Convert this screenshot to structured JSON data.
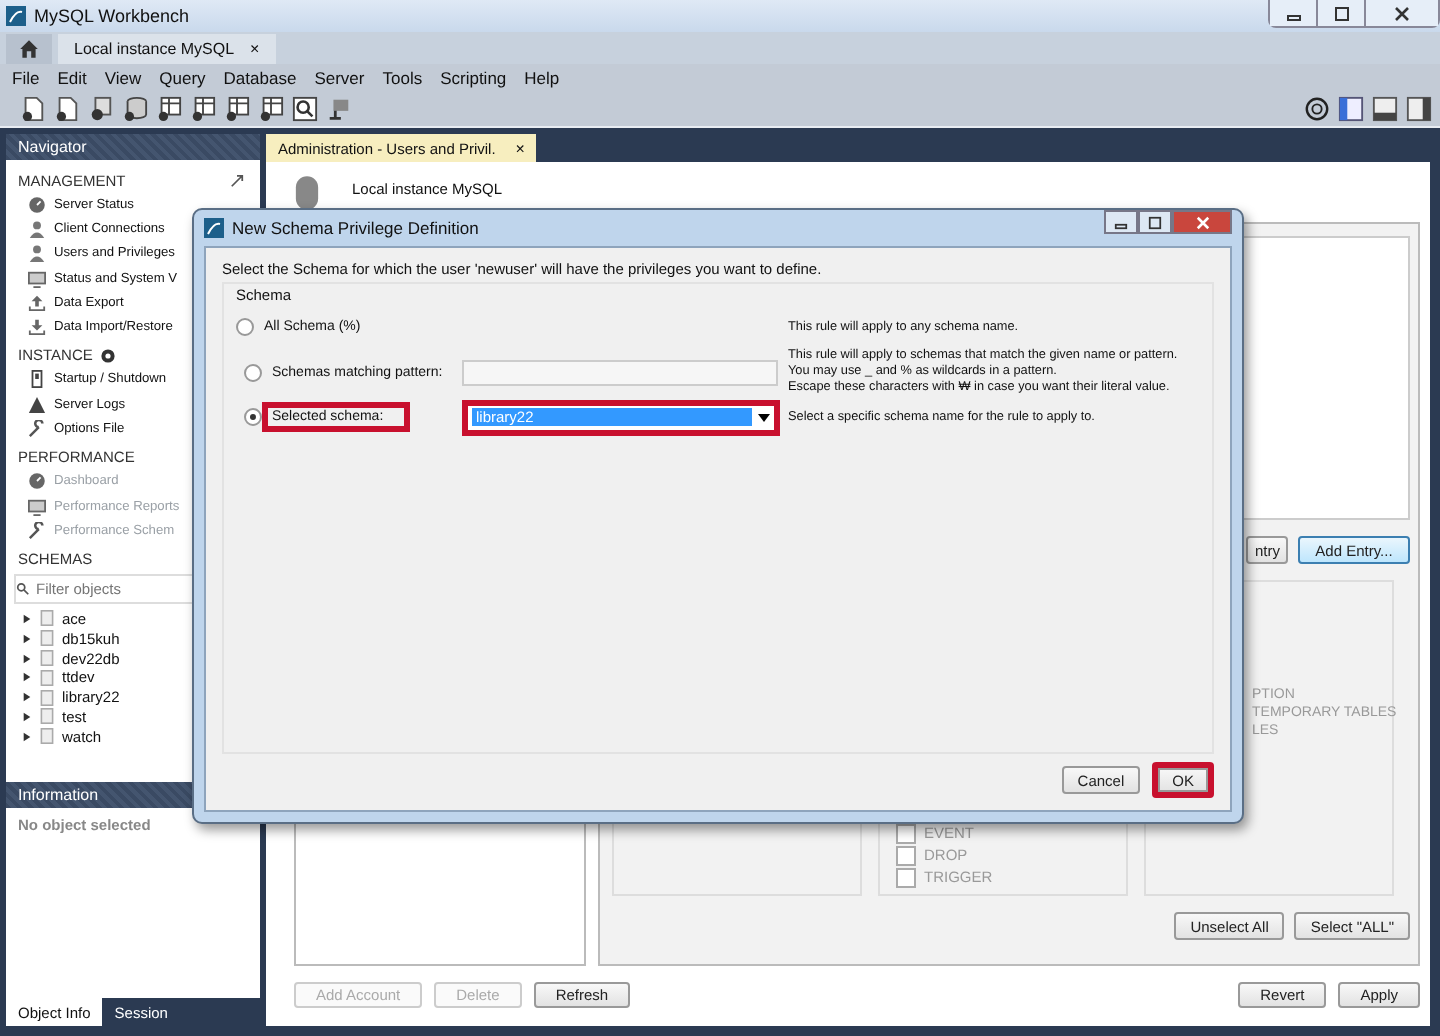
{
  "window": {
    "title": "MySQL Workbench"
  },
  "connection_tabs": [
    {
      "kind": "home",
      "selected": false
    },
    {
      "kind": "connection",
      "label": "Local instance MySQL",
      "close": "×",
      "selected": true
    }
  ],
  "menu": [
    "File",
    "Edit",
    "View",
    "Query",
    "Database",
    "Server",
    "Tools",
    "Scripting",
    "Help"
  ],
  "navigator": {
    "title": "Navigator",
    "sections": [
      {
        "title": "MANAGEMENT",
        "items": [
          {
            "label": "Server Status",
            "kind": "gauge",
            "disabled": false
          },
          {
            "label": "Client Connections",
            "kind": "person",
            "disabled": false
          },
          {
            "label": "Users and Privileges",
            "kind": "person",
            "disabled": false
          },
          {
            "label": "Status and System V",
            "kind": "monitor",
            "disabled": false
          },
          {
            "label": "Data Export",
            "kind": "upload",
            "disabled": false
          },
          {
            "label": "Data Import/Restore",
            "kind": "download",
            "disabled": false
          }
        ]
      },
      {
        "title": "INSTANCE",
        "items": [
          {
            "label": "Startup / Shutdown",
            "kind": "power",
            "disabled": false
          },
          {
            "label": "Server Logs",
            "kind": "warning",
            "disabled": false
          },
          {
            "label": "Options File",
            "kind": "wrench",
            "disabled": false
          }
        ]
      },
      {
        "title": "PERFORMANCE",
        "items": [
          {
            "label": "Dashboard",
            "kind": "gauge",
            "disabled": true
          },
          {
            "label": "Performance Reports",
            "kind": "monitor",
            "disabled": true
          },
          {
            "label": "Performance Schem",
            "kind": "wrench",
            "disabled": true
          }
        ]
      }
    ],
    "schemas_title": "SCHEMAS",
    "filter": {
      "placeholder": "Filter objects"
    },
    "schemas": [
      "ace",
      "db15kuh",
      "dev22db",
      "ttdev",
      "library22",
      "test",
      "watch"
    ]
  },
  "information": {
    "title": "Information",
    "text": "No object selected",
    "tabs": [
      {
        "label": "Object Info",
        "selected": true
      },
      {
        "label": "Session",
        "selected": false
      }
    ]
  },
  "editor_tab": {
    "label": "Administration - Users and Privil.",
    "close": "×"
  },
  "admin": {
    "connection": "Local instance MySQL",
    "entry_buttons": [
      "ntry",
      "Add Entry..."
    ],
    "privileges_right": [
      "PTION",
      "TEMPORARY TABLES",
      "LES"
    ],
    "privileges_mid": [
      {
        "label": "EVENT",
        "checked": false
      },
      {
        "label": "DROP",
        "checked": false
      },
      {
        "label": "TRIGGER",
        "checked": false
      }
    ],
    "select_buttons": [
      "Unselect All",
      "Select \"ALL\""
    ],
    "account_buttons": [
      {
        "label": "Add Account",
        "disabled": true
      },
      {
        "label": "Delete",
        "disabled": true
      },
      {
        "label": "Refresh",
        "disabled": false
      }
    ],
    "apply_buttons": [
      "Revert",
      "Apply"
    ]
  },
  "dialog": {
    "title": "New Schema Privilege Definition",
    "intro": "Select the Schema for which the user 'newuser' will have the privileges you want to define.",
    "group": "Schema",
    "options": [
      {
        "label": "All Schema (%)",
        "kind": "plain",
        "selected": false,
        "highlighted": false,
        "description": [
          "This rule will apply to any schema name."
        ]
      },
      {
        "label": "Schemas matching pattern:",
        "kind": "pattern",
        "selected": false,
        "highlighted": false,
        "description": [
          "This rule will apply to schemas that match the given name or pattern.",
          "You may use _ and % as wildcards in a pattern.",
          "Escape these characters with ₩ in case you want their literal value."
        ]
      },
      {
        "label": "Selected schema:",
        "kind": "select",
        "selected": true,
        "highlighted": true,
        "value": "library22",
        "description": [
          "Select a specific schema name for the rule to apply to."
        ]
      }
    ],
    "buttons": [
      {
        "label": "Cancel",
        "highlighted": false
      },
      {
        "label": "OK",
        "highlighted": true
      }
    ]
  }
}
